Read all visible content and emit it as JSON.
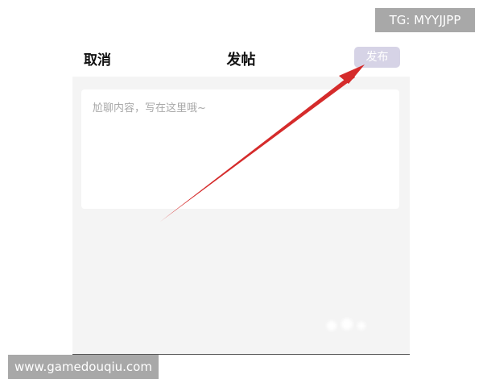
{
  "header": {
    "cancel_label": "取消",
    "title": "发帖",
    "publish_label": "发布"
  },
  "editor": {
    "placeholder": "尬聊内容，写在这里哦~"
  },
  "watermarks": {
    "telegram": "TG: MYYJJPP",
    "site": "www.gamedouqiu.com"
  },
  "colors": {
    "publish_button_bg": "#d6d3e6",
    "body_bg": "#f4f4f4",
    "arrow": "#d52b2b",
    "badge_bg": "#a8a8a8"
  },
  "icons": {
    "annotation": "red-arrow-icon"
  }
}
